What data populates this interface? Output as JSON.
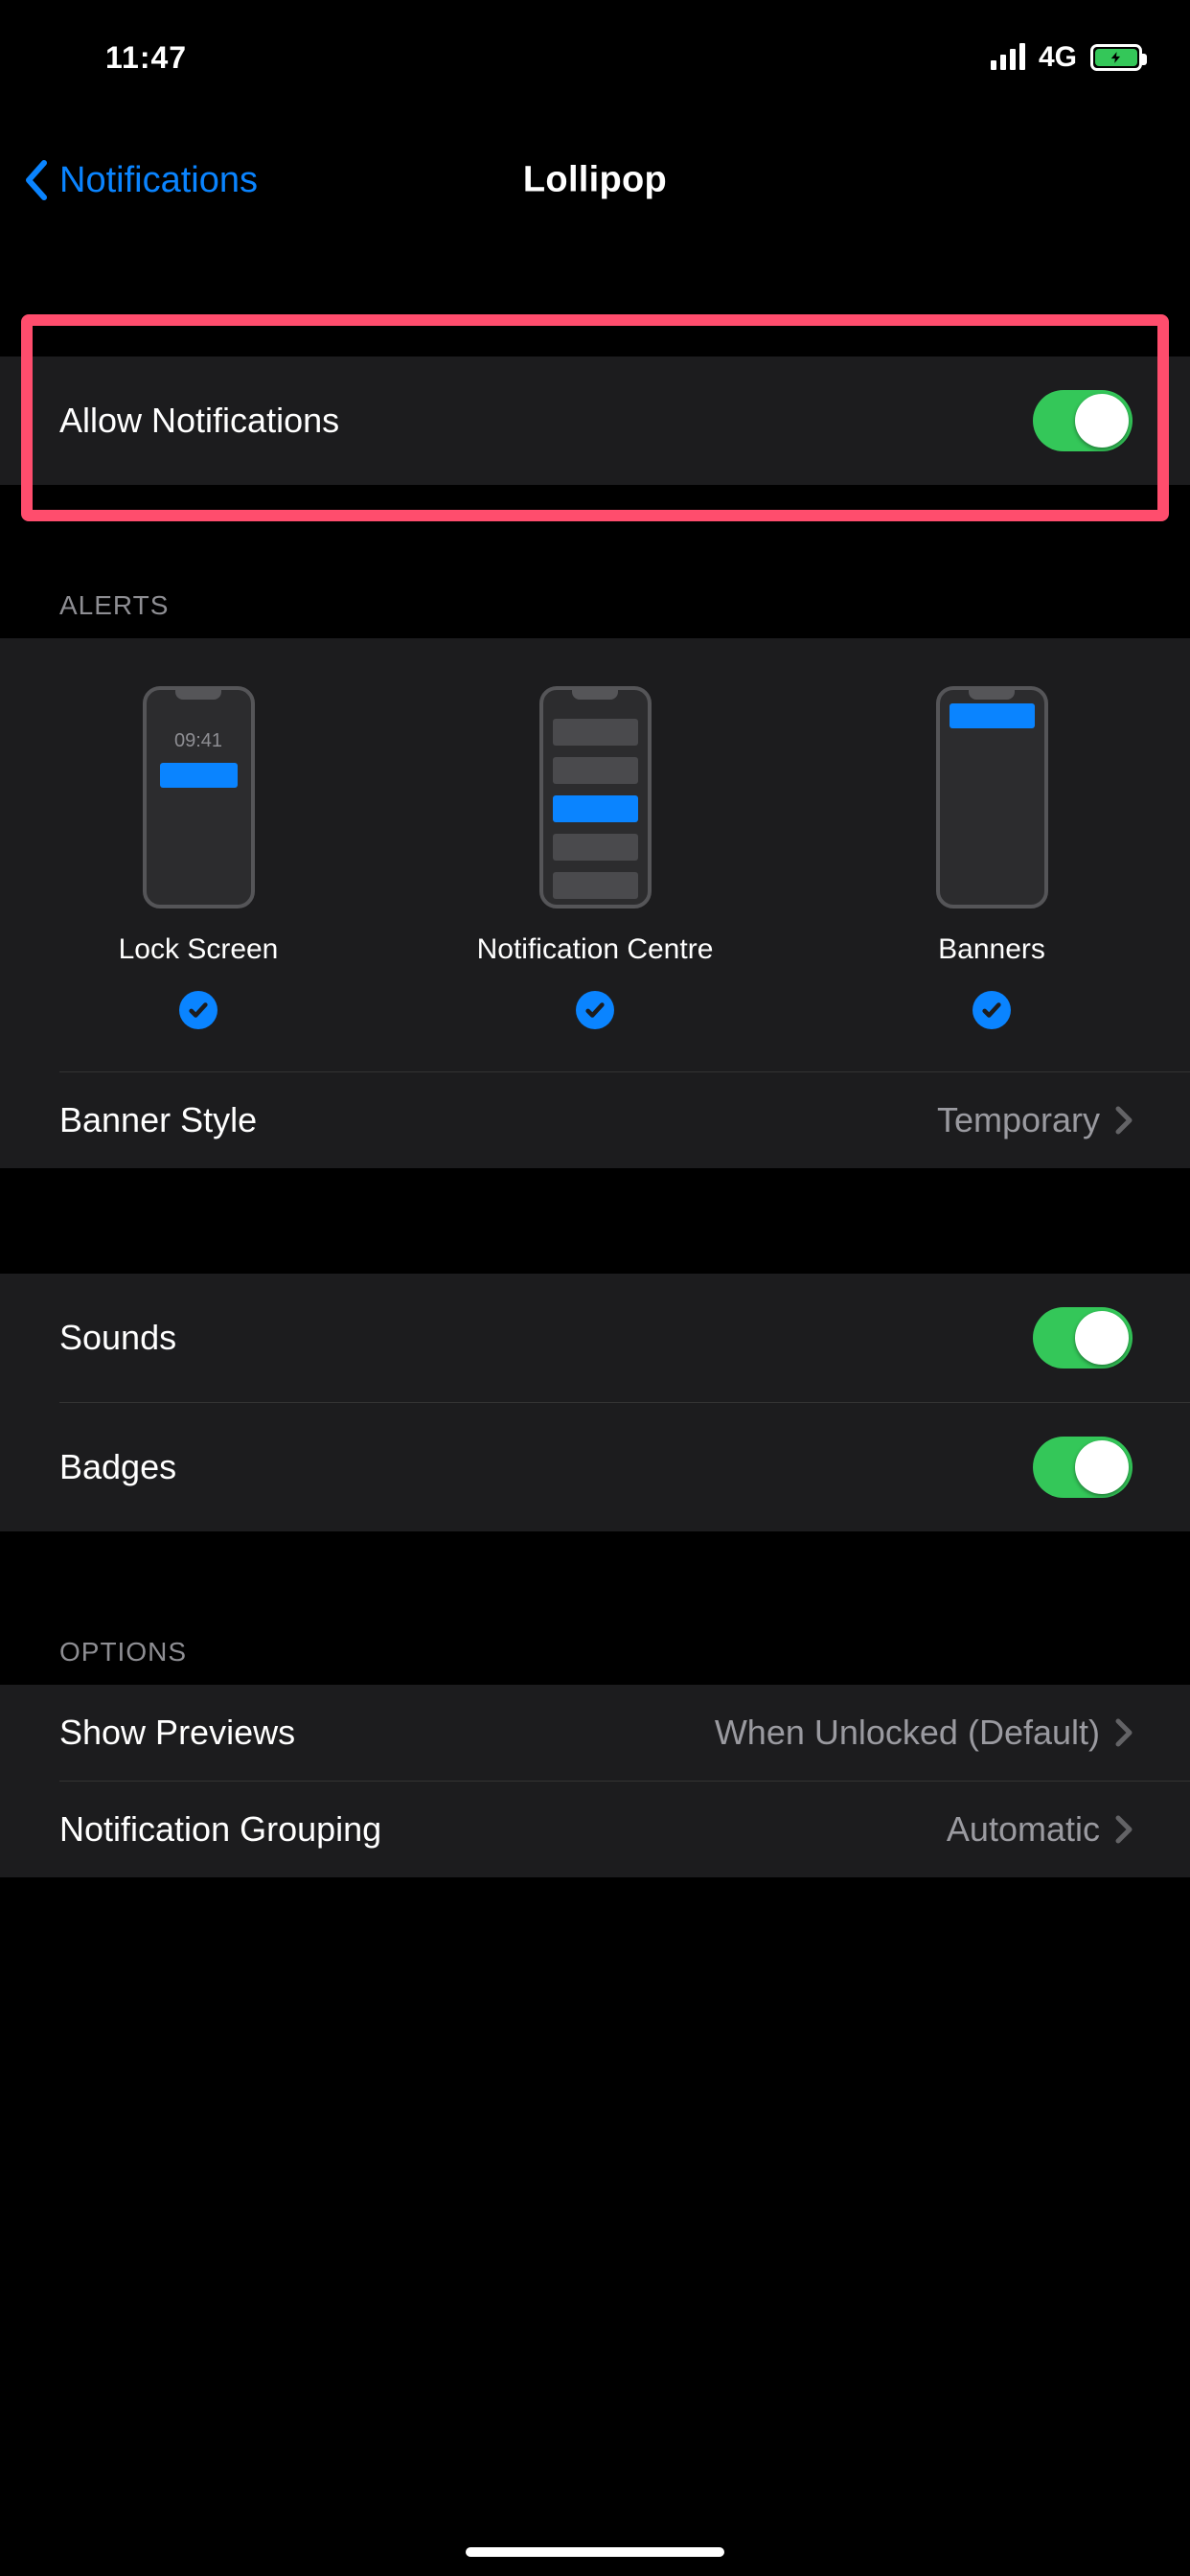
{
  "status": {
    "time": "11:47",
    "cellular_label": "4G"
  },
  "nav": {
    "back_label": "Notifications",
    "title": "Lollipop"
  },
  "allow": {
    "label": "Allow Notifications",
    "on": true
  },
  "alerts": {
    "header": "ALERTS",
    "lock_screen": {
      "label": "Lock Screen",
      "checked": true,
      "clock": "09:41"
    },
    "notification_centre": {
      "label": "Notification Centre",
      "checked": true
    },
    "banners": {
      "label": "Banners",
      "checked": true
    },
    "banner_style": {
      "label": "Banner Style",
      "value": "Temporary"
    }
  },
  "sounds": {
    "label": "Sounds",
    "on": true
  },
  "badges": {
    "label": "Badges",
    "on": true
  },
  "options": {
    "header": "OPTIONS",
    "show_previews": {
      "label": "Show Previews",
      "value": "When Unlocked (Default)"
    },
    "notification_grouping": {
      "label": "Notification Grouping",
      "value": "Automatic"
    }
  },
  "colors": {
    "accent": "#0a84ff",
    "toggle_on": "#34C759",
    "highlight": "#ff4d6d"
  }
}
